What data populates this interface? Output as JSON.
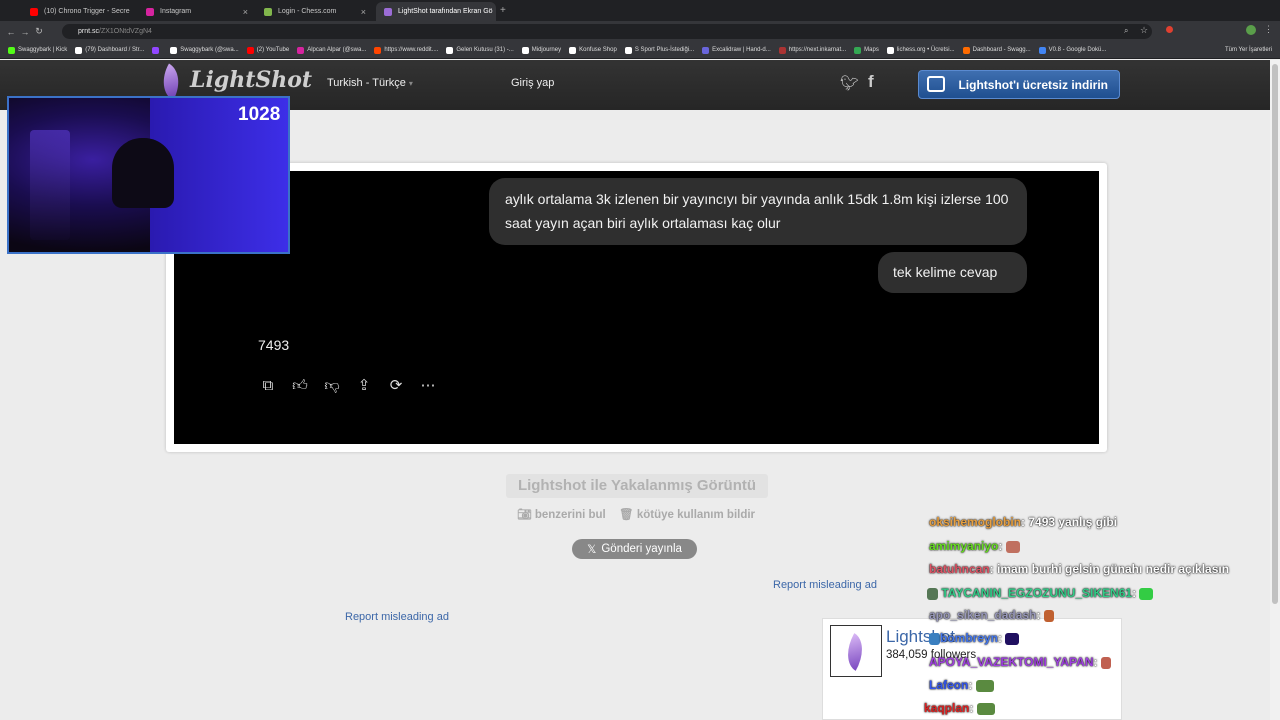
{
  "browser": {
    "tabs": [
      {
        "label": "(10) Chrono Trigger - Secre",
        "fav": "#ff0000"
      },
      {
        "label": "Instagram",
        "fav": "#d6249f"
      },
      {
        "label": "Login - Chess.com",
        "fav": "#81b64c"
      },
      {
        "label": "LightShot tarafından Ekran Gö",
        "fav": "#9b6cd6"
      }
    ],
    "url_host": "prnt.sc",
    "url_path": "/ZX1ONtdVZgN4",
    "bookmarks": [
      {
        "label": "Swaggybark | Kick",
        "color": "#53fc18"
      },
      {
        "label": "(79) Dashboard / Str...",
        "color": "#ffffff"
      },
      {
        "label": "",
        "color": "#9146ff"
      },
      {
        "label": "Swaggybark (@swa...",
        "color": "#ffffff"
      },
      {
        "label": "(2) YouTube",
        "color": "#ff0000"
      },
      {
        "label": "Alpcan Alpar (@swa...",
        "color": "#d6249f"
      },
      {
        "label": "https://www.reddit....",
        "color": "#ff4500"
      },
      {
        "label": "Gelen Kutusu (31) -...",
        "color": "#ffffff"
      },
      {
        "label": "Midjourney",
        "color": "#ffffff"
      },
      {
        "label": "Konfuse Shop",
        "color": "#ffffff"
      },
      {
        "label": "S Sport Plus-İstediği...",
        "color": "#ffffff"
      },
      {
        "label": "Excalidraw | Hand-d...",
        "color": "#6965db"
      },
      {
        "label": "https://next.inkarnat...",
        "color": "#aa3333"
      },
      {
        "label": "Maps",
        "color": "#34a853"
      },
      {
        "label": "lichess.org • Ücretsi...",
        "color": "#ffffff"
      },
      {
        "label": "Dashboard - Swagg...",
        "color": "#ff6b00"
      },
      {
        "label": "V0.8 - Google Dokü...",
        "color": "#4285f4"
      }
    ],
    "all_bookmarks": "Tüm Yer İşaretleri"
  },
  "header": {
    "logo": "LightShot",
    "language": "Turkish - Türkçe",
    "login": "Giriş yap",
    "download": "Lightshot'ı ücretsiz indirin"
  },
  "screenshot": {
    "question": "aylık ortalama 3k izlenen bir yayıncıyı bir yayında anlık 15dk 1.8m kişi izlerse 100 saat yayın açan biri aylık ortalaması kaç olur",
    "instruction": "tek kelime cevap",
    "answer": "7493"
  },
  "below": {
    "caption": "Lightshot ile Yakalanmış Görüntü",
    "similar": "benzerini bul",
    "report_abuse": "kötüye kullanım bildir",
    "post_x": "Gönderi yayınla",
    "report_ad_1": "Report misleading ad",
    "report_ad_2": "Report misleading ad"
  },
  "webcam": {
    "viewers": "1028"
  },
  "widget": {
    "name": "Lightshot",
    "followers": "384,059 followers"
  },
  "chat": [
    {
      "user": "oksihemoglobin",
      "color": "#e8a040",
      "msg": ": 7493 yanlış gibi"
    },
    {
      "user": "amimyaniyo",
      "color": "#66dd22",
      "msg": ":"
    },
    {
      "user": "batuhncan",
      "color": "#e05566",
      "msg": ": imam burhi gelsin günahı nedir açıklasın"
    },
    {
      "user": "TAYCANIN_EGZOZUNU_SIKEN61",
      "color": "#33cc88",
      "msg": ":"
    },
    {
      "user": "apo_siken_dadash",
      "color": "#9999bb",
      "msg": ":"
    },
    {
      "user": "bombreyn",
      "color": "#4477ee",
      "msg": ":"
    },
    {
      "user": "APOYA_VAZEKTOMI_YAPAN",
      "color": "#a040e0",
      "msg": ":"
    },
    {
      "user": "Lafeon",
      "color": "#3355ee",
      "msg": ":"
    },
    {
      "user": "kaqplan",
      "color": "#dd2222",
      "msg": ":"
    }
  ]
}
